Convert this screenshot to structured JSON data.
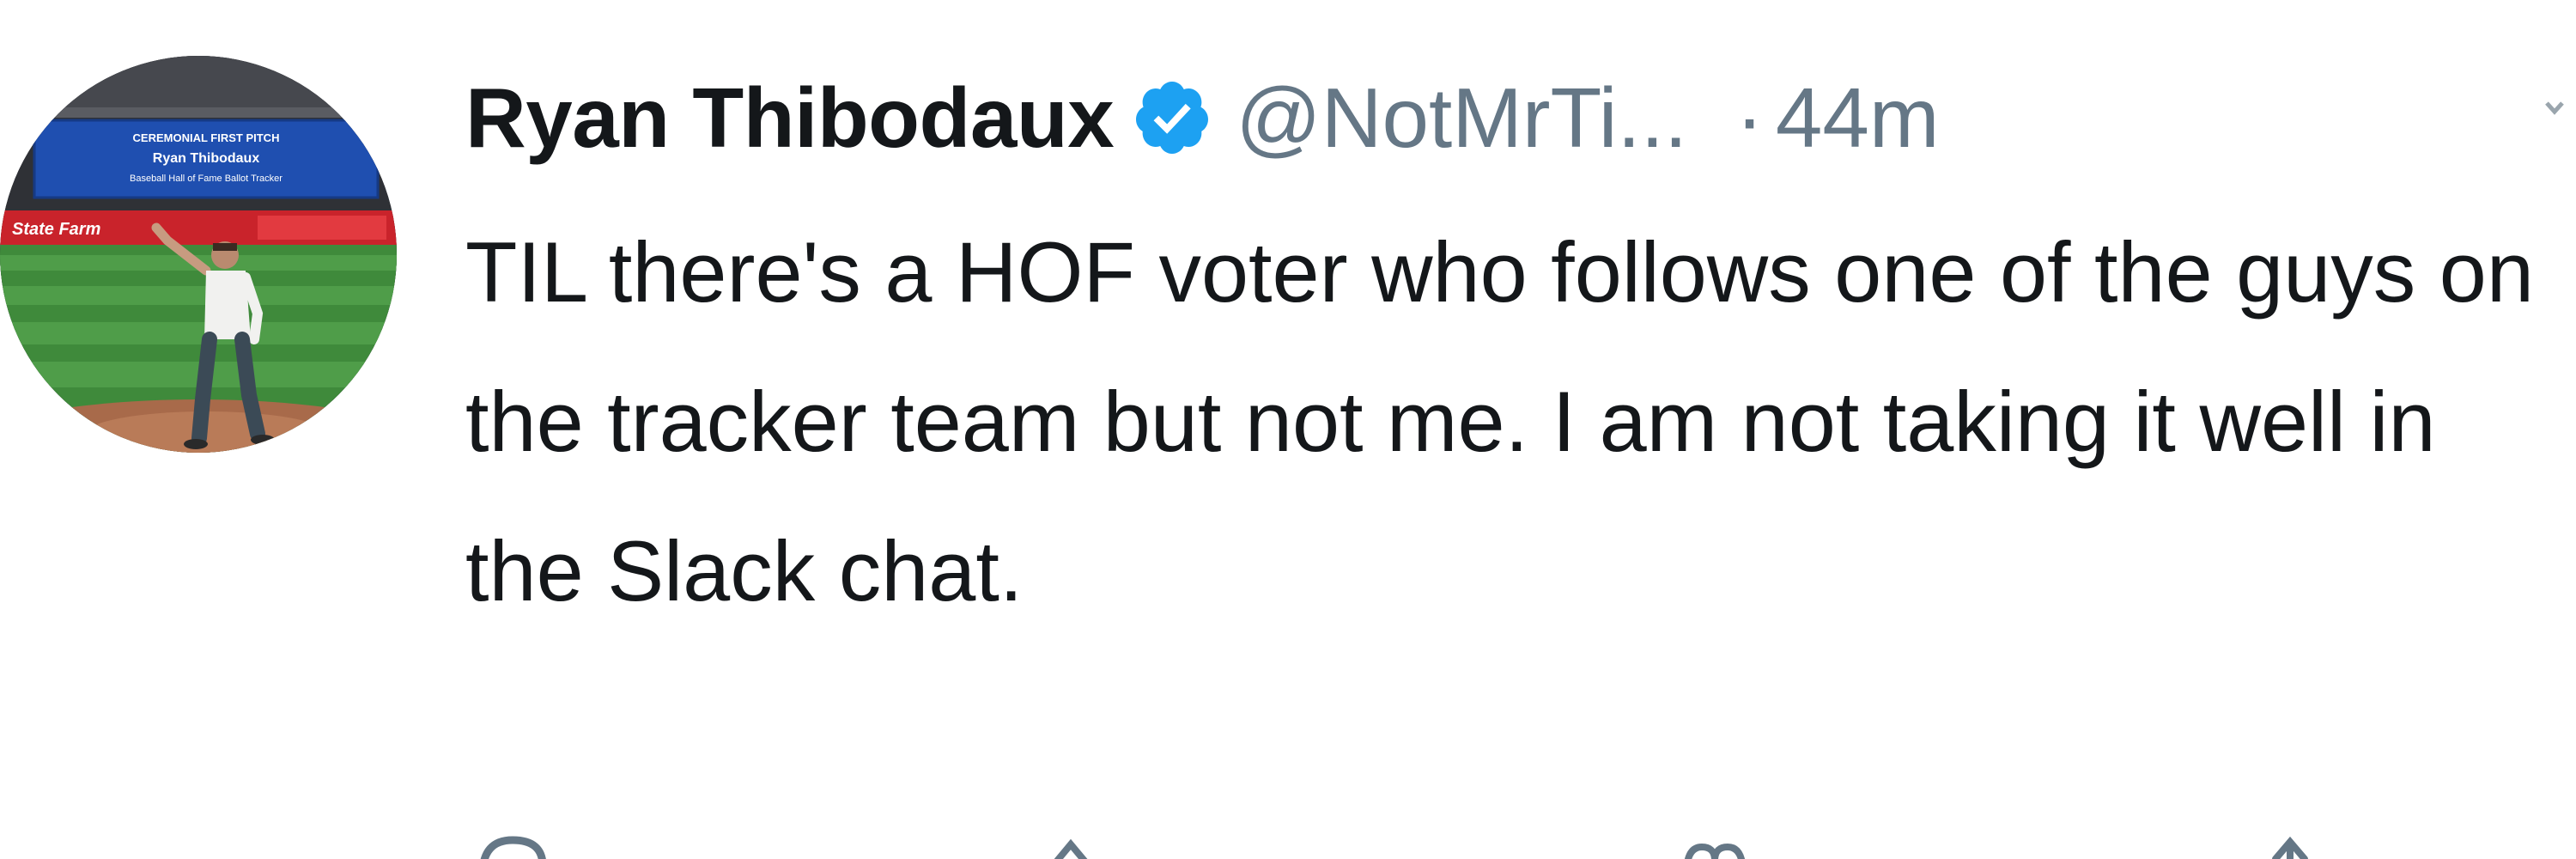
{
  "tweet": {
    "author": {
      "display_name": "Ryan Thibodaux",
      "handle": "@NotMrTi...",
      "verified": true,
      "verified_color": "#1da1f2"
    },
    "separator": "·",
    "timestamp": "44m",
    "text": "TIL there's a HOF voter who follows one of the guys on the tracker team but not me. I am not taking it well in the Slack chat.",
    "avatar_scoreboard": {
      "line1": "CEREMONIAL FIRST PITCH",
      "line2": "Ryan Thibodaux",
      "line3": "Baseball Hall of Fame Ballot Tracker",
      "sponsor": "State Farm"
    },
    "actions": [
      {
        "name": "reply",
        "icon": "reply-icon"
      },
      {
        "name": "retweet",
        "icon": "retweet-icon"
      },
      {
        "name": "like",
        "icon": "heart-icon"
      },
      {
        "name": "share",
        "icon": "share-icon"
      }
    ]
  }
}
